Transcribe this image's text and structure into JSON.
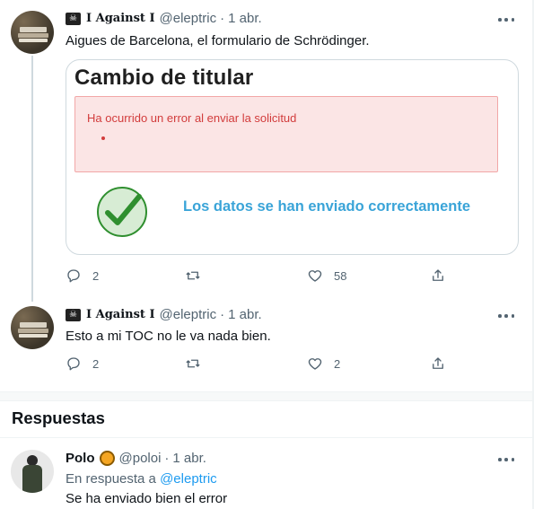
{
  "colors": {
    "link": "#1d9bf0",
    "muted": "#536471",
    "error": "#d23c3c",
    "success": "#3aa4d8",
    "check_green": "#2f8f2f"
  },
  "tweets": [
    {
      "name": "𝐈 𝐀𝐠𝐚𝐢𝐧𝐬𝐭 𝐈",
      "handle": "@eleptric",
      "dot": "·",
      "date": "1 abr.",
      "text": "Aigues de Barcelona, el formulario de Schrödinger.",
      "media": {
        "title": "Cambio de titular",
        "error_message": "Ha ocurrido un error al enviar la solicitud",
        "success_message": "Los datos se han enviado correctamente"
      },
      "actions": {
        "replies": "2",
        "retweets": "",
        "likes": "58"
      }
    },
    {
      "name": "𝐈 𝐀𝐠𝐚𝐢𝐧𝐬𝐭 𝐈",
      "handle": "@eleptric",
      "dot": "·",
      "date": "1 abr.",
      "text": "Esto a mi TOC no le va nada bien.",
      "actions": {
        "replies": "2",
        "retweets": "",
        "likes": "2"
      }
    }
  ],
  "section_title": "Respuestas",
  "reply": {
    "name": "Polo",
    "handle": "@poloi",
    "dot": "·",
    "date": "1 abr.",
    "reply_prefix": "En respuesta a",
    "reply_target": "@eleptric",
    "text": "Se ha enviado bien el error"
  },
  "icons": [
    "flag-icon",
    "more-icon",
    "reply-icon",
    "retweet-icon",
    "like-icon",
    "share-icon",
    "check-icon",
    "emoji-icon"
  ]
}
